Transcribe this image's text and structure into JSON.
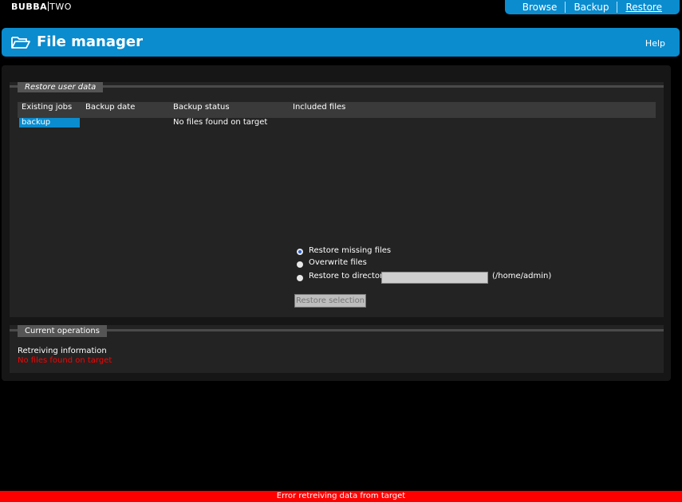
{
  "brand": {
    "bold": "BUBBA",
    "light": "TWO"
  },
  "topnav": {
    "items": [
      "Browse",
      "Backup",
      "Restore"
    ],
    "active": "Restore"
  },
  "header": {
    "title": "File manager",
    "help": "Help",
    "icon": "folder-open-icon"
  },
  "restore": {
    "legend": "Restore user data",
    "columns": [
      "Existing jobs",
      "Backup date",
      "Backup status",
      "Included files"
    ],
    "rows": [
      {
        "job": "backup",
        "date": "",
        "status": "No files found on target",
        "files": ""
      }
    ],
    "options": {
      "missing": "Restore missing files",
      "overwrite": "Overwrite files",
      "directory": "Restore to directory",
      "selected": "missing"
    },
    "directory_value": "",
    "directory_hint": "(/home/admin)",
    "button": "Restore selection"
  },
  "operations": {
    "legend": "Current operations",
    "status": "Retreiving information",
    "error": "No files found on target"
  },
  "error_bar": "Error retreiving data from target",
  "colors": {
    "accent": "#0a8ccf",
    "error": "#ff0000"
  }
}
